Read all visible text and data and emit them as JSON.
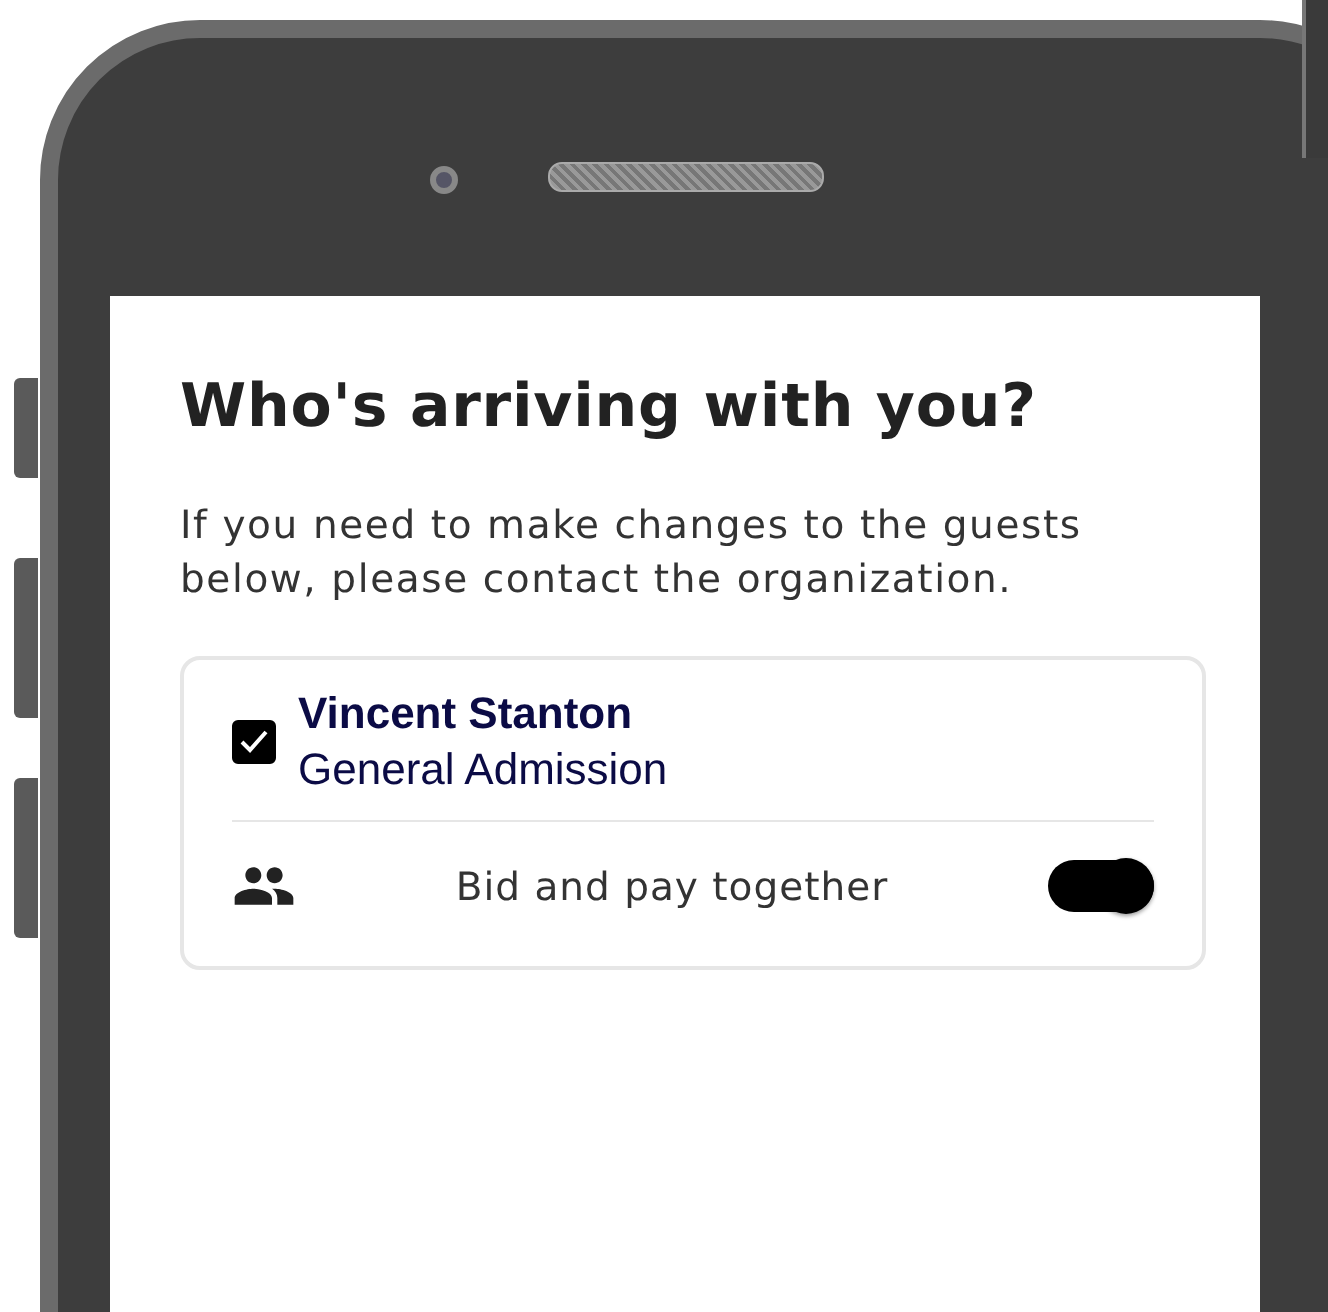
{
  "title": "Who's arriving with you?",
  "description": "If you need to make changes to the guests below, please contact the organization.",
  "guests": [
    {
      "name": "Vincent Stanton",
      "ticket": "General Admission",
      "checked": true
    }
  ],
  "group_option": {
    "label": "Bid and pay together",
    "on": true
  }
}
